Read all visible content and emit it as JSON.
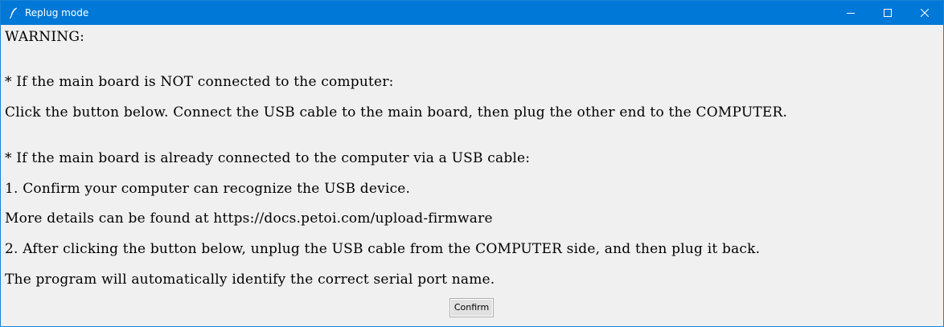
{
  "window": {
    "title": "Replug mode",
    "accent_color": "#0078d7",
    "icon": "feather-icon"
  },
  "controls": {
    "minimize_icon": "minimize-icon",
    "maximize_icon": "maximize-icon",
    "close_icon": "close-icon"
  },
  "message": {
    "warning": "WARNING:",
    "not_connected_header": "* If the main board is NOT connected to the computer:",
    "not_connected_instruction": "Click the button below. Connect the USB cable to the main board, then plug the other end to the COMPUTER.",
    "connected_header": "* If the main board is already connected to the computer via a USB cable:",
    "step1": "1. Confirm your computer can recognize the USB device.",
    "details": "More details can be found at https://docs.petoi.com/upload-firmware",
    "step2": "2. After clicking the button below, unplug the USB cable from the COMPUTER side, and then plug it back.",
    "auto_identify": "The program will automatically identify the correct serial port name."
  },
  "actions": {
    "confirm_label": "Confirm"
  }
}
